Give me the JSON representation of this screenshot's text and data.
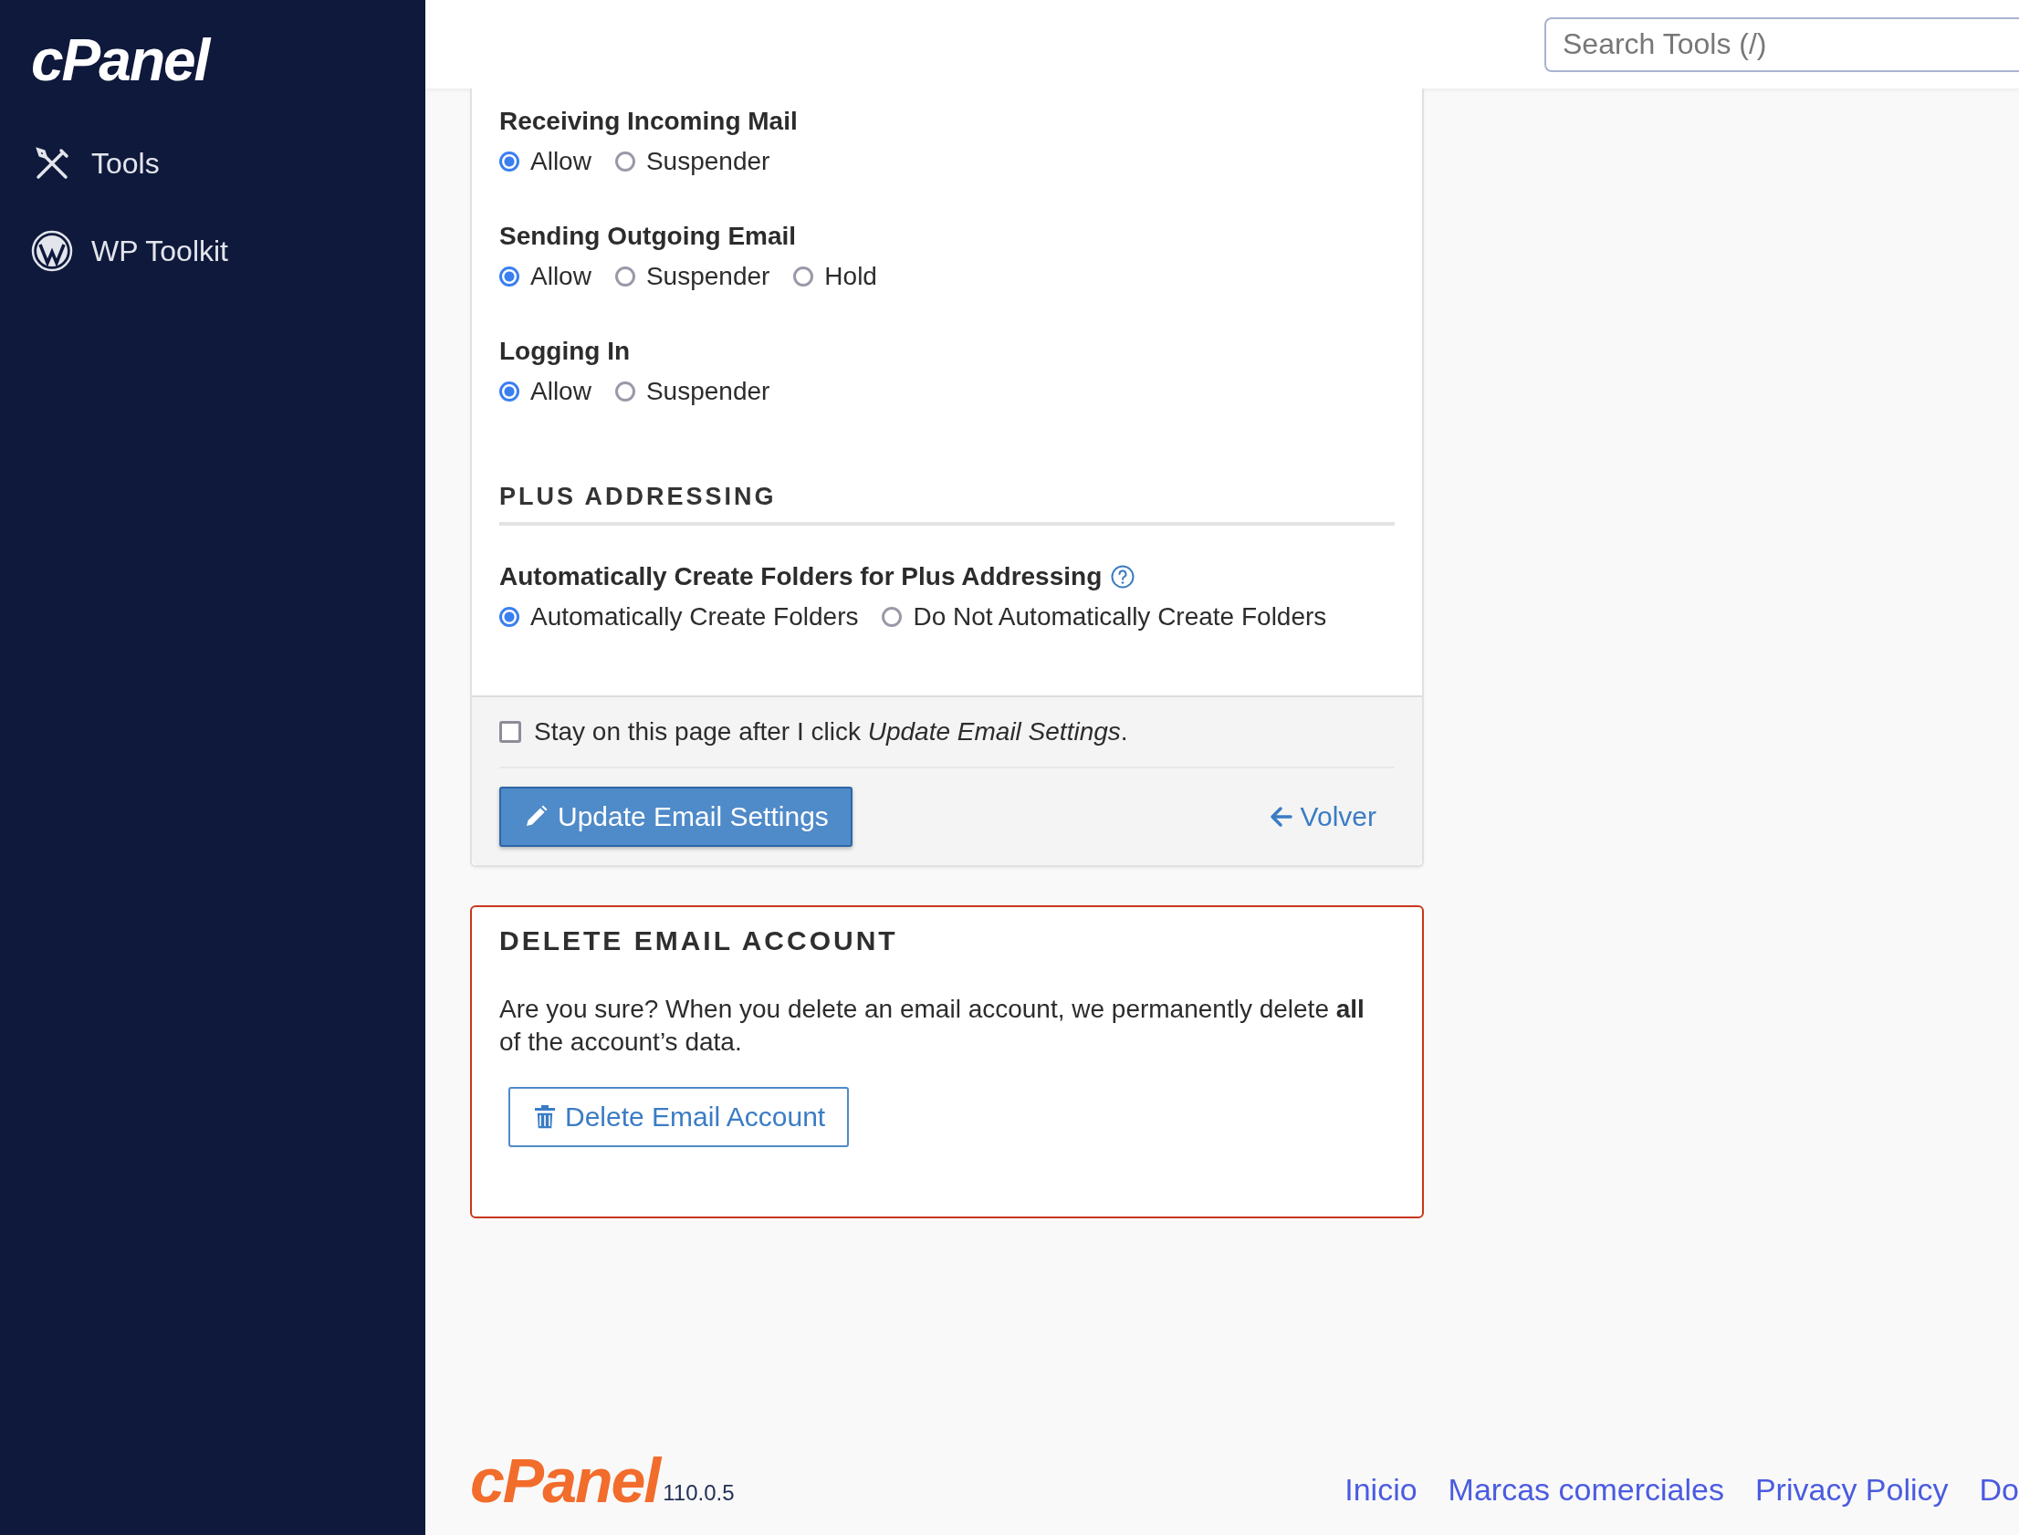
{
  "sidebar": {
    "logo": "cPanel",
    "items": [
      {
        "label": "Tools",
        "kind": "tools"
      },
      {
        "label": "WP Toolkit",
        "kind": "wordpress"
      }
    ]
  },
  "header": {
    "search": {
      "placeholder": "Search Tools (/)"
    }
  },
  "settings": {
    "groups": [
      {
        "label": "Receiving Incoming Mail",
        "options": [
          {
            "label": "Allow",
            "selected": true
          },
          {
            "label": "Suspender",
            "selected": false
          }
        ]
      },
      {
        "label": "Sending Outgoing Email",
        "options": [
          {
            "label": "Allow",
            "selected": true
          },
          {
            "label": "Suspender",
            "selected": false
          },
          {
            "label": "Hold",
            "selected": false
          }
        ]
      },
      {
        "label": "Logging In",
        "options": [
          {
            "label": "Allow",
            "selected": true
          },
          {
            "label": "Suspender",
            "selected": false
          }
        ]
      }
    ],
    "plus_addressing": {
      "heading": "PLUS ADDRESSING",
      "label": "Automatically Create Folders for Plus Addressing",
      "options": [
        {
          "label": "Automatically Create Folders",
          "selected": true
        },
        {
          "label": "Do Not Automatically Create Folders",
          "selected": false
        }
      ]
    },
    "stay_checkbox": {
      "label": "Stay on this page after I click *Update Email Settings*.",
      "checked": false
    },
    "update_button": "Update Email Settings",
    "back_link": "Volver"
  },
  "delete_account": {
    "heading": "DELETE EMAIL ACCOUNT",
    "text": "Are you sure? When you delete an email account, we permanently delete **all** of the account’s data.",
    "button": "Delete Email Account"
  },
  "footer": {
    "logo": "cPanel",
    "version": "110.0.5",
    "links": [
      "Inicio",
      "Marcas comerciales",
      "Privacy Policy",
      "Do"
    ]
  }
}
